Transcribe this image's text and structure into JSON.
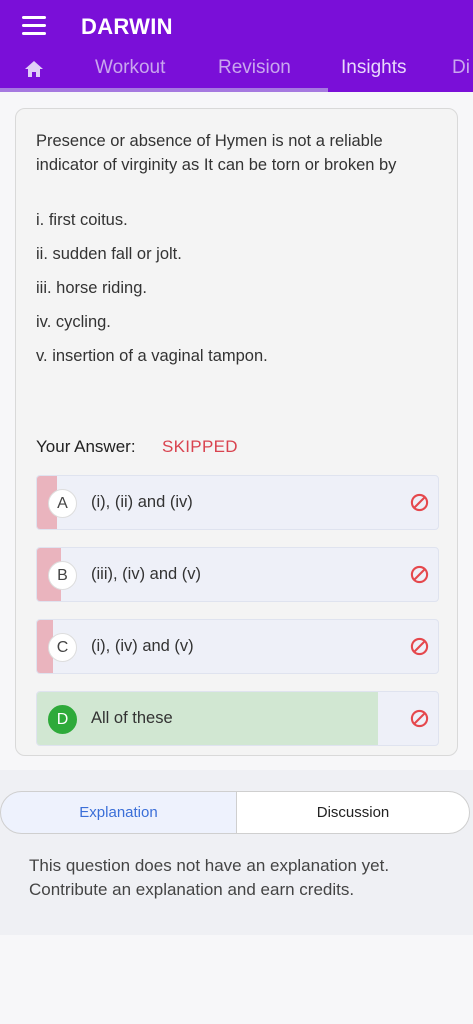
{
  "app": {
    "title": "DARWIN"
  },
  "tabs": [
    "Workout",
    "Revision",
    "Insights",
    "Di"
  ],
  "question": {
    "text": "Presence or absence of Hymen is not a reliable indicator of virginity as It can be torn or broken by",
    "items": [
      "i. first coitus.",
      "ii. sudden fall or jolt.",
      "iii. horse riding.",
      "iv. cycling.",
      "v. insertion of a vaginal tampon."
    ]
  },
  "answer": {
    "label": "Your Answer:",
    "value": "SKIPPED"
  },
  "options": [
    {
      "letter": "A",
      "text": "(i), (ii) and (iv)",
      "share": 0.05,
      "correct": false
    },
    {
      "letter": "B",
      "text": "(iii), (iv) and (v)",
      "share": 0.06,
      "correct": false
    },
    {
      "letter": "C",
      "text": "(i), (iv) and (v)",
      "share": 0.04,
      "correct": false
    },
    {
      "letter": "D",
      "text": "All of these",
      "share": 0.85,
      "correct": true
    }
  ],
  "bottom_tabs": {
    "explanation": "Explanation",
    "discussion": "Discussion"
  },
  "explanation_text": "This question does not have an explanation yet. Contribute an explanation and earn credits.",
  "colors": {
    "primary": "#7a0fd8",
    "skipped": "#d9434f",
    "correct": "#2eaa3a",
    "wrong_bar": "#eab4be",
    "correct_bar": "#d1e7d2",
    "block_icon": "#e5484d"
  },
  "icons": {
    "menu": "hamburger-menu-icon",
    "home": "home-icon",
    "block": "block-icon"
  }
}
